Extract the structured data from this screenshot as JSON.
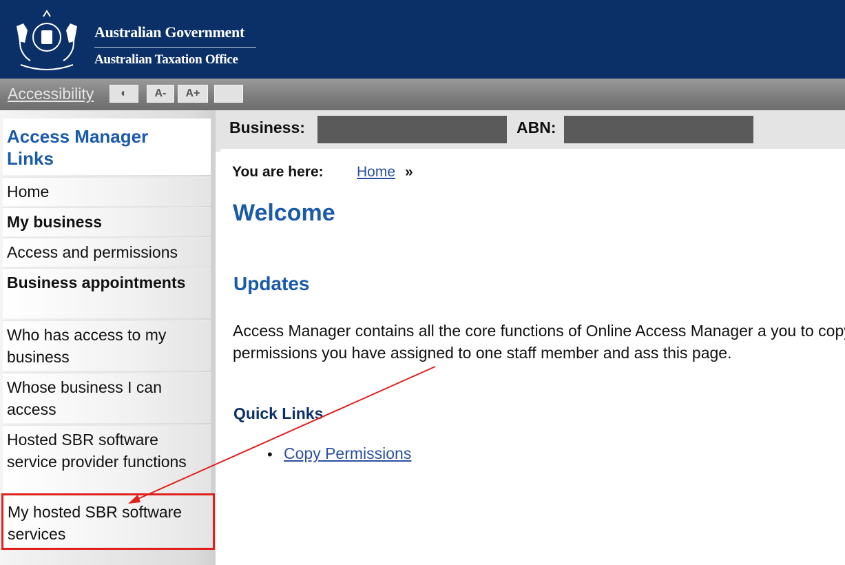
{
  "header": {
    "line1": "Australian Government",
    "line2": "Australian Taxation Office",
    "colors": {
      "banner": "#0b3068"
    }
  },
  "accessibility": {
    "label": "Accessibility",
    "buttons": [
      {
        "icon": "contrast-icon",
        "text": "◐"
      },
      {
        "icon": "text-smaller-icon",
        "text": "A-"
      },
      {
        "icon": "text-larger-icon",
        "text": "A+"
      },
      {
        "icon": "blank-toggle-icon",
        "text": ""
      }
    ]
  },
  "sidebar": {
    "title": "Access Manager Links",
    "items": [
      {
        "label": "Home"
      },
      {
        "label": "My business"
      },
      {
        "label": "Access and permissions"
      },
      {
        "label": "Business appointments"
      },
      {
        "label": "Who has access to my business"
      },
      {
        "label": "Whose business I can access"
      },
      {
        "label": "Hosted SBR software service provider functions"
      },
      {
        "label": "My hosted SBR software services"
      }
    ]
  },
  "business_bar": {
    "business_label": "Business:",
    "abn_label": "ABN:"
  },
  "breadcrumb": {
    "label": "You are here:",
    "home": "Home",
    "separator": "»"
  },
  "main": {
    "title": "Welcome",
    "section": "Updates",
    "description": "Access Manager contains all the core functions of Online Access Manager a you to copy the permissions you have assigned to one staff member and ass this page.",
    "quick_links_heading": "Quick Links",
    "quick_links": [
      {
        "label": "Copy Permissions"
      }
    ]
  },
  "annotation": {
    "color": "#e0201c"
  }
}
